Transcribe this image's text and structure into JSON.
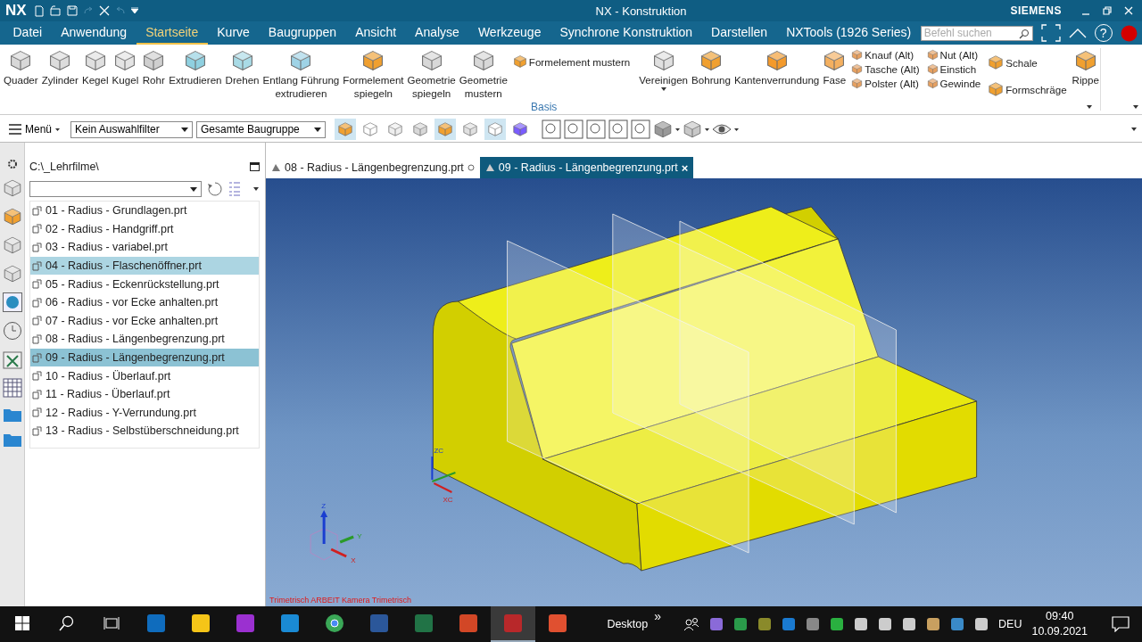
{
  "title_bar": {
    "logo": "NX",
    "title": "NX - Konstruktion",
    "brand": "SIEMENS"
  },
  "menu": {
    "tabs": [
      {
        "label": "Datei",
        "selected": false
      },
      {
        "label": "Anwendung",
        "selected": false
      },
      {
        "label": "Startseite",
        "selected": true
      },
      {
        "label": "Kurve",
        "selected": false
      },
      {
        "label": "Baugruppen",
        "selected": false
      },
      {
        "label": "Ansicht",
        "selected": false
      },
      {
        "label": "Analyse",
        "selected": false
      },
      {
        "label": "Werkzeuge",
        "selected": false
      },
      {
        "label": "Synchrone Konstruktion",
        "selected": false
      },
      {
        "label": "Darstellen",
        "selected": false
      },
      {
        "label": "NXTools (1926 Series)",
        "selected": false
      }
    ],
    "search": {
      "placeholder": "Befehl suchen"
    },
    "help": "?"
  },
  "ribbon": {
    "items": [
      {
        "kind": "large",
        "label": "Quader",
        "dropdown": false
      },
      {
        "kind": "large",
        "label": "Zylinder",
        "dropdown": false
      },
      {
        "kind": "large",
        "label": "Kegel",
        "dropdown": false
      },
      {
        "kind": "large",
        "label": "Kugel",
        "dropdown": false
      },
      {
        "kind": "large",
        "label": "Rohr",
        "dropdown": false
      },
      {
        "kind": "large",
        "label": "Extrudieren",
        "dropdown": false
      },
      {
        "kind": "large",
        "label": "Drehen",
        "dropdown": false
      },
      {
        "kind": "large",
        "label": "Entlang Führung\nextrudieren",
        "dropdown": false
      },
      {
        "kind": "large",
        "label": "Formelement\nspiegeln",
        "dropdown": false
      },
      {
        "kind": "large",
        "label": "Geometrie\nspiegeln",
        "dropdown": false
      },
      {
        "kind": "large",
        "label": "Geometrie\nmustern",
        "dropdown": false
      },
      {
        "kind": "inline",
        "label": "Formelement mustern"
      },
      {
        "kind": "large",
        "label": "Vereinigen",
        "dropdown": true
      },
      {
        "kind": "large",
        "label": "Bohrung",
        "dropdown": false
      },
      {
        "kind": "large",
        "label": "Kantenverrundung",
        "dropdown": false
      },
      {
        "kind": "large",
        "label": "Fase",
        "dropdown": false
      },
      {
        "kind": "column",
        "labels": [
          "Knauf (Alt)",
          "Tasche (Alt)",
          "Polster (Alt)"
        ]
      },
      {
        "kind": "column",
        "labels": [
          "Nut (Alt)",
          "Einstich",
          "Gewinde"
        ]
      },
      {
        "kind": "column",
        "labels": [
          "Schale",
          "Formschräge"
        ]
      },
      {
        "kind": "large",
        "label": "Rippe",
        "dropdown": false
      }
    ],
    "group_label": "Basis"
  },
  "toolbar": {
    "menu_label": "Menü",
    "filters": [
      {
        "value": "Kein Auswahlfilter"
      },
      {
        "value": "Gesamte Baugruppe"
      }
    ],
    "selection_tools": [
      {
        "on": true
      },
      {
        "on": false
      },
      {
        "on": false
      },
      {
        "on": false
      },
      {
        "on": true
      },
      {
        "on": false
      },
      {
        "on": true
      },
      {
        "on": false
      }
    ]
  },
  "navigator": {
    "path": "C:\\_Lehrfilme\\",
    "files": [
      {
        "name": "01 - Radius - Grundlagen.prt",
        "selected": false,
        "hovered": false
      },
      {
        "name": "02 - Radius - Handgriff.prt",
        "selected": false,
        "hovered": false
      },
      {
        "name": "03 - Radius - variabel.prt",
        "selected": false,
        "hovered": false
      },
      {
        "name": "04 - Radius - Flaschenöffner.prt",
        "selected": false,
        "hovered": true
      },
      {
        "name": "05 - Radius - Eckenrückstellung.prt",
        "selected": false,
        "hovered": false
      },
      {
        "name": "06 - Radius - vor Ecke anhalten.prt",
        "selected": false,
        "hovered": false
      },
      {
        "name": "07 - Radius - vor Ecke anhalten.prt",
        "selected": false,
        "hovered": false
      },
      {
        "name": "08 - Radius - Längenbegrenzung.prt",
        "selected": false,
        "hovered": false
      },
      {
        "name": "09 - Radius - Längenbegrenzung.prt",
        "selected": true,
        "hovered": false
      },
      {
        "name": "10 - Radius - Überlauf.prt",
        "selected": false,
        "hovered": false
      },
      {
        "name": "11 - Radius - Überlauf.prt",
        "selected": false,
        "hovered": false
      },
      {
        "name": "12 - Radius - Y-Verrundung.prt",
        "selected": false,
        "hovered": false
      },
      {
        "name": "13 - Radius - Selbstüberschneidung.prt",
        "selected": false,
        "hovered": false
      }
    ]
  },
  "document_tabs": [
    {
      "label": "08 - Radius - Längenbegrenzung.prt",
      "selected": false
    },
    {
      "label": "09 - Radius - Längenbegrenzung.prt",
      "selected": true,
      "close": "×"
    }
  ],
  "viewport": {
    "wcs_labels": [
      "ZC",
      "XC"
    ],
    "axis_labels": [
      "Z",
      "Y",
      "X"
    ],
    "view_status": "Trimetrisch ARBEIT Kamera Trimetrisch"
  },
  "taskbar": {
    "apps": [
      {
        "running": false,
        "active": false
      },
      {
        "running": false,
        "active": false
      },
      {
        "running": false,
        "active": false
      },
      {
        "running": false,
        "active": false
      },
      {
        "running": false,
        "active": false
      },
      {
        "running": false,
        "active": false
      },
      {
        "running": false,
        "active": false
      },
      {
        "running": false,
        "active": false
      },
      {
        "running": true,
        "active": true
      },
      {
        "running": false,
        "active": false
      }
    ],
    "desktop_label": "Desktop",
    "overflow": "»",
    "language": "DEU",
    "time": "09:40",
    "date": "10.09.2021"
  }
}
